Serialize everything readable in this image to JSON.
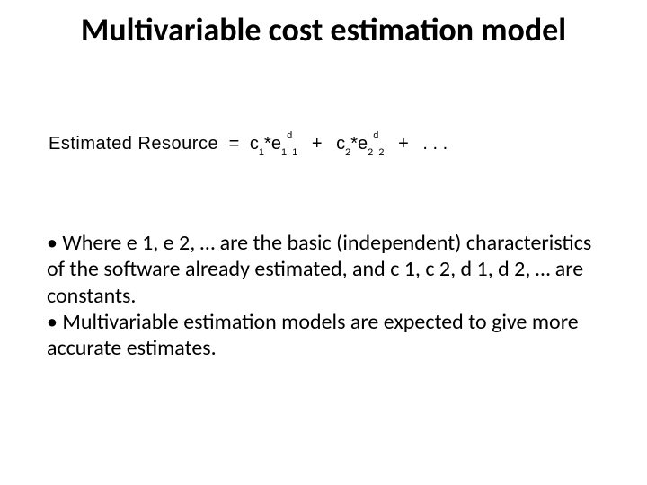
{
  "title": "Multivariable cost estimation model",
  "formula": {
    "label": "Estimated Resource",
    "eq": "=",
    "t1_c": "c",
    "t1_cs": "1",
    "star": "*",
    "t1_e": "e",
    "t1_es": "1",
    "t1_d": "d",
    "t1_ds": "1",
    "plus": "+",
    "t2_c": "c",
    "t2_cs": "2",
    "t2_e": "e",
    "t2_es": "2",
    "t2_d": "d",
    "t2_ds": "2",
    "dots": ". . ."
  },
  "bullets": {
    "b1": "Where e 1, e 2, … are the basic (independent) characteristics of the software already estimated, and c 1, c 2, d 1, d 2, … are constants.",
    "b2": "Multivariable estimation models are expected to give more accurate estimates."
  }
}
